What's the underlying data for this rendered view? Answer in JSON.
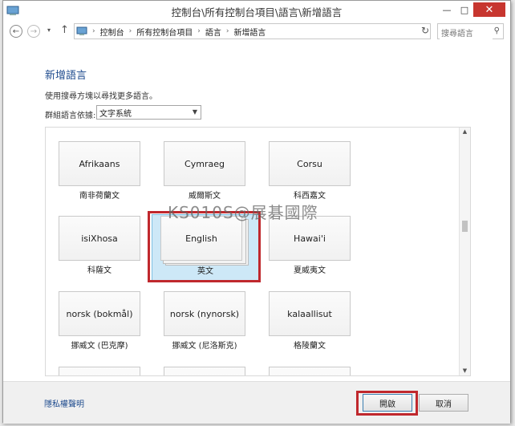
{
  "window": {
    "title": "控制台\\所有控制台項目\\語言\\新增語言",
    "minimize": "—",
    "maximize": "□",
    "close": "✕"
  },
  "address": {
    "back": "←",
    "forward": "→",
    "dropdown": "▾",
    "up": "↑",
    "breadcrumb": [
      "控制台",
      "所有控制台項目",
      "語言",
      "新增語言"
    ],
    "separator": "›",
    "refresh": "↻",
    "search_placeholder": "搜尋語言"
  },
  "content": {
    "heading": "新增語言",
    "description": "使用搜尋方塊以尋找更多語言。",
    "group_label": "群組語言依據:",
    "group_value": "文字系統",
    "languages": [
      {
        "name": "Afrikaans",
        "native": "南非荷蘭文"
      },
      {
        "name": "Cymraeg",
        "native": "威爾斯文"
      },
      {
        "name": "Corsu",
        "native": "科西嘉文"
      },
      {
        "name": "isiXhosa",
        "native": "科薩文"
      },
      {
        "name": "English",
        "native": "英文"
      },
      {
        "name": "Hawai'i",
        "native": "夏威夷文"
      },
      {
        "name": "norsk (bokmål)",
        "native": "挪威文 (巴克摩)"
      },
      {
        "name": "norsk (nynorsk)",
        "native": "挪威文 (尼洛斯克)"
      },
      {
        "name": "kalaallisut",
        "native": "格陵蘭文"
      }
    ],
    "watermark": "KS010S@展碁國際"
  },
  "footer": {
    "privacy": "隱私權聲明",
    "open": "開啟",
    "cancel": "取消"
  },
  "colors": {
    "accent": "#1e4b8e",
    "highlight": "#c0282d",
    "selected_bg": "#cde8f7"
  }
}
